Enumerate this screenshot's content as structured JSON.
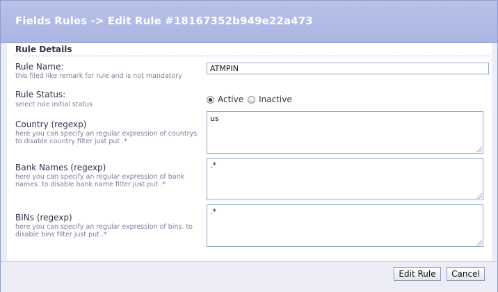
{
  "window": {
    "title": "Fields Rules -> Edit Rule #18167352b949e22a473"
  },
  "section": {
    "title": "Rule Details"
  },
  "fields": {
    "rule_name": {
      "label": "Rule Name:",
      "hint": "this filed like remark for rule and is not mandatory",
      "value": "ATMPIN"
    },
    "rule_status": {
      "label": "Rule Status:",
      "hint": "select rule initial status",
      "options": [
        "Active",
        "Inactive"
      ],
      "selected": "Active"
    },
    "country": {
      "label": "Country (regexp)",
      "hint": "here you can specify an regular expression of countrys. to disable country filter just put .*",
      "value": "us"
    },
    "bank_names": {
      "label": "Bank Names (regexp)",
      "hint": "here you can specify an regular expression of bank names. to disable bank name filter just put .*",
      "value": ".*"
    },
    "bins": {
      "label": "BINs (regexp)",
      "hint": "here you can specify an regular expression of bins. to disable bins filter just put .*",
      "value": ".*"
    }
  },
  "buttons": {
    "edit_rule": "Edit Rule",
    "cancel": "Cancel"
  },
  "colors": {
    "title_bar": "#aab5e2",
    "panel_bg": "#ecedf7",
    "field_border": "#8fa3c8"
  }
}
